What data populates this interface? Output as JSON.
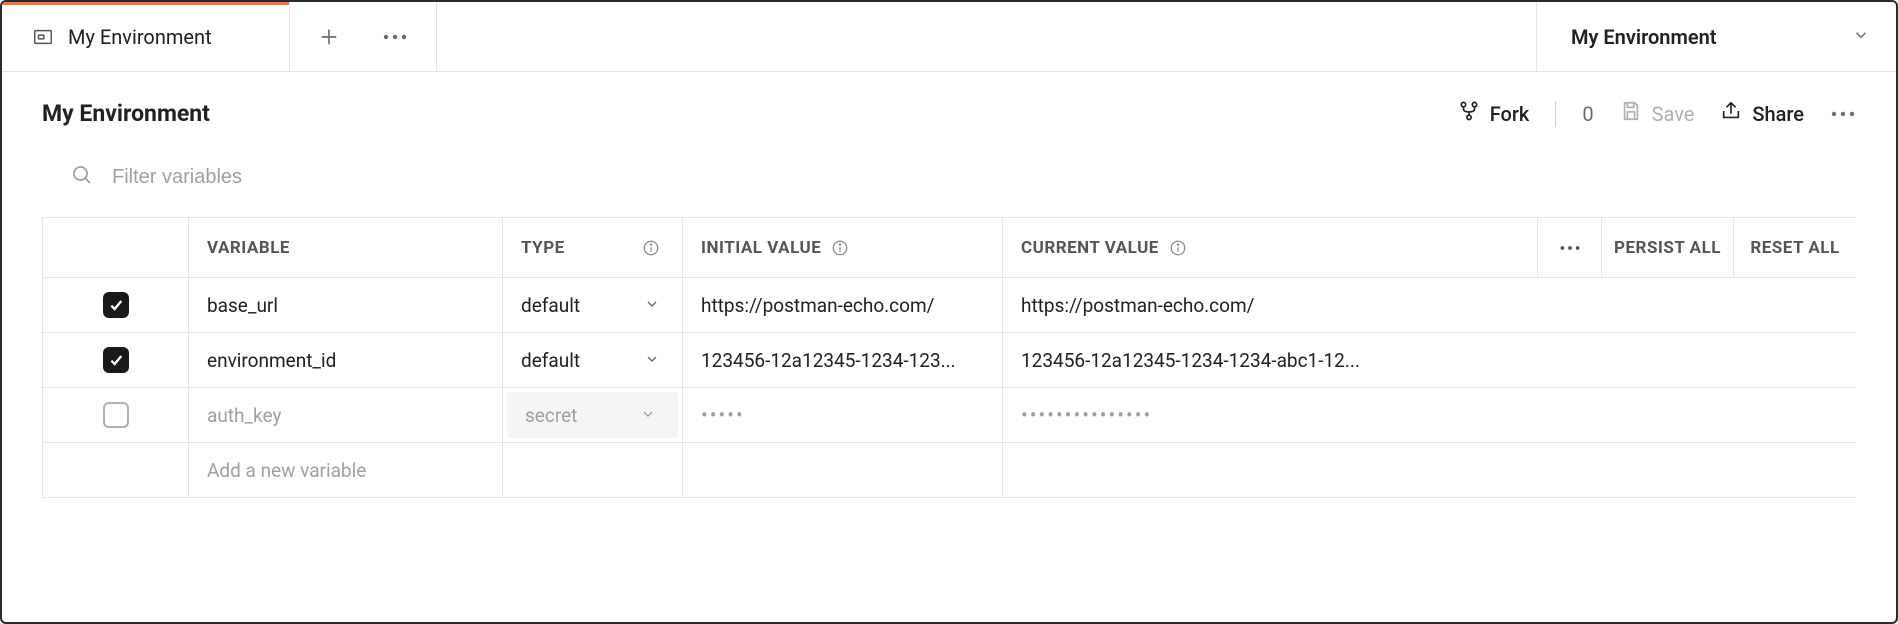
{
  "tab": {
    "label": "My Environment"
  },
  "env_selector": {
    "label": "My Environment"
  },
  "header": {
    "title": "My Environment"
  },
  "actions": {
    "fork": "Fork",
    "fork_count": "0",
    "save": "Save",
    "share": "Share"
  },
  "filter": {
    "placeholder": "Filter variables"
  },
  "table": {
    "headers": {
      "variable": "Variable",
      "type": "Type",
      "initial_value": "Initial Value",
      "current_value": "Current Value",
      "persist_all": "Persist All",
      "reset_all": "Reset All"
    },
    "rows": [
      {
        "checked": true,
        "variable": "base_url",
        "type": "default",
        "initial_value": "https://postman-echo.com/",
        "current_value": "https://postman-echo.com/",
        "secret": false
      },
      {
        "checked": true,
        "variable": "environment_id",
        "type": "default",
        "initial_value": "123456-12a12345-1234-123...",
        "current_value": "123456-12a12345-1234-1234-abc1-12...",
        "secret": false
      },
      {
        "checked": false,
        "variable": "auth_key",
        "type": "secret",
        "initial_value": "•••••",
        "current_value": "•••••••••••••••",
        "secret": true,
        "muted": true
      }
    ],
    "new_row_placeholder": "Add a new variable"
  }
}
